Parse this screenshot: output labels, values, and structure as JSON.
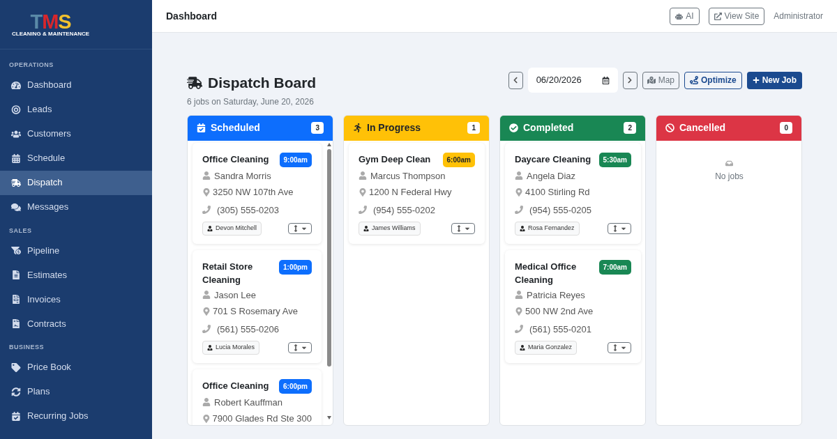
{
  "logo": {
    "letters": [
      {
        "char": "T",
        "color": "#5a8aa8"
      },
      {
        "char": "M",
        "color": "#d9262b"
      },
      {
        "char": "S",
        "color": "#f2c12e"
      }
    ],
    "tagline": "CLEANING & MAINTENANCE"
  },
  "sidebar": {
    "sections": [
      {
        "heading": "OPERATIONS",
        "items": [
          {
            "label": "Dashboard",
            "selected": false
          },
          {
            "label": "Leads",
            "selected": false
          },
          {
            "label": "Customers",
            "selected": false
          },
          {
            "label": "Schedule",
            "selected": false
          },
          {
            "label": "Dispatch",
            "selected": true
          },
          {
            "label": "Messages",
            "selected": false
          }
        ]
      },
      {
        "heading": "SALES",
        "items": [
          {
            "label": "Pipeline",
            "selected": false
          },
          {
            "label": "Estimates",
            "selected": false
          },
          {
            "label": "Invoices",
            "selected": false
          },
          {
            "label": "Contracts",
            "selected": false
          }
        ]
      },
      {
        "heading": "BUSINESS",
        "items": [
          {
            "label": "Price Book",
            "selected": false
          },
          {
            "label": "Plans",
            "selected": false
          },
          {
            "label": "Recurring Jobs",
            "selected": false
          }
        ]
      }
    ]
  },
  "topbar": {
    "title": "Dashboard",
    "buttons": [
      "AI",
      "View Site"
    ],
    "user": "Administrator"
  },
  "board": {
    "title": "Dispatch Board",
    "subtitle": "6 jobs on Saturday, June 20, 2026",
    "date": "06/20/2026",
    "map_button": "Map",
    "optimize_button": "Optimize",
    "new_job_button": "New Job"
  },
  "columns": [
    {
      "kind": "scheduled",
      "title": "Scheduled",
      "count": "3",
      "color": "#0d6efd",
      "scrollable": true,
      "jobs": [
        {
          "title": "Office Cleaning",
          "time": "9:00am",
          "customer": "Sandra Morris",
          "address": "3250 NW 107th Ave",
          "phone": "(305) 555-0203",
          "assignee": "Devon Mitchell"
        },
        {
          "title": "Retail Store Cleaning",
          "time": "1:00pm",
          "customer": "Jason Lee",
          "address": "701 S Rosemary Ave",
          "phone": "(561) 555-0206",
          "assignee": "Lucia Morales"
        },
        {
          "title": "Office Cleaning",
          "time": "6:00pm",
          "customer": "Robert Kauffman",
          "address": "7900 Glades Rd Ste 300"
        }
      ]
    },
    {
      "kind": "in_progress",
      "title": "In Progress",
      "count": "1",
      "color": "#ffc107",
      "scrollable": false,
      "jobs": [
        {
          "title": "Gym Deep Clean",
          "time": "6:00am",
          "customer": "Marcus Thompson",
          "address": "1200 N Federal Hwy",
          "phone": "(954) 555-0202",
          "assignee": "James Williams"
        }
      ]
    },
    {
      "kind": "completed",
      "title": "Completed",
      "count": "2",
      "color": "#198754",
      "scrollable": false,
      "jobs": [
        {
          "title": "Daycare Cleaning",
          "time": "5:30am",
          "customer": "Angela Diaz",
          "address": "4100 Stirling Rd",
          "phone": "(954) 555-0205",
          "assignee": "Rosa Fernandez"
        },
        {
          "title": "Medical Office Cleaning",
          "time": "7:00am",
          "customer": "Patricia Reyes",
          "address": "500 NW 2nd Ave",
          "phone": "(561) 555-0201",
          "assignee": "Maria Gonzalez"
        }
      ]
    },
    {
      "kind": "cancelled",
      "title": "Cancelled",
      "count": "0",
      "color": "#dc3545",
      "scrollable": false,
      "empty_text": "No jobs"
    }
  ]
}
